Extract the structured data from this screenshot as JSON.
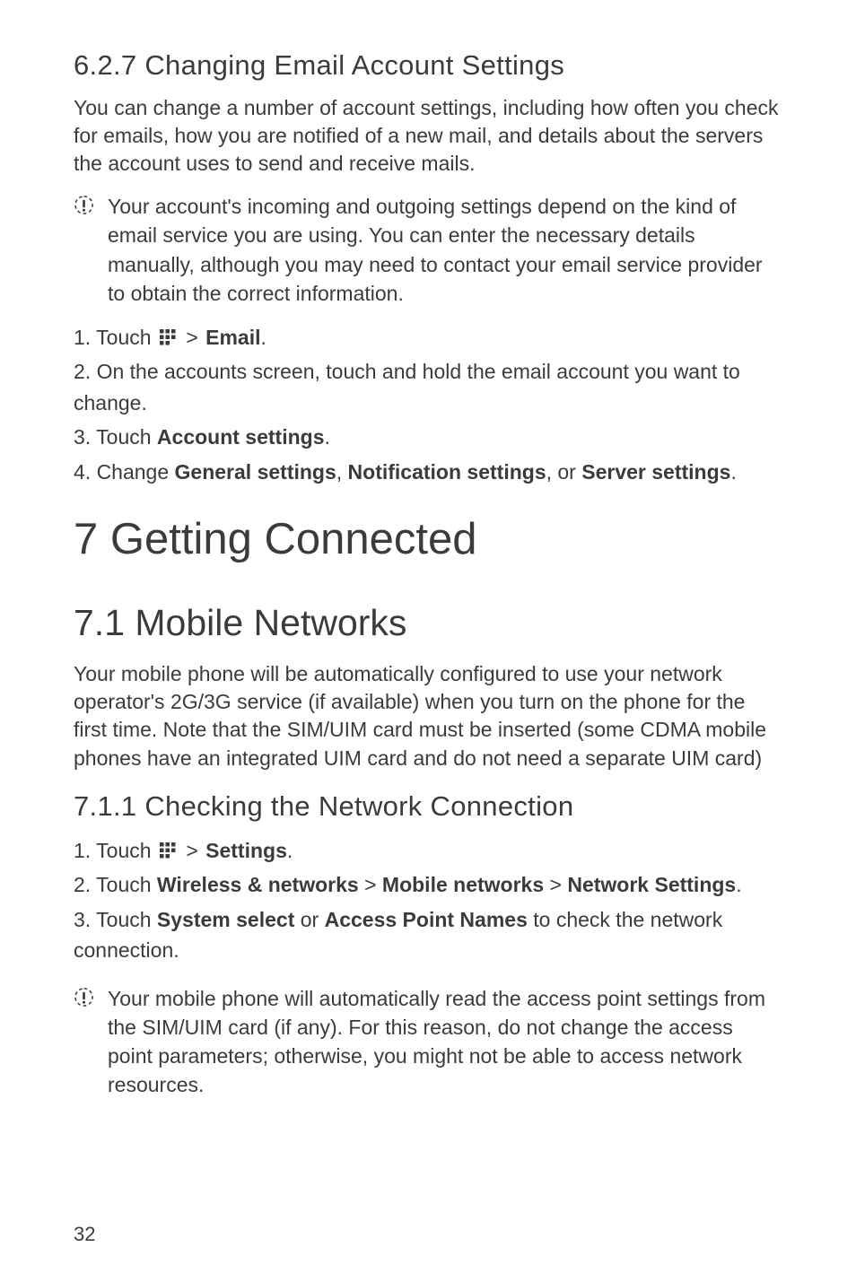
{
  "sec627": {
    "heading": "6.2.7  Changing Email Account Settings",
    "intro": "You can change a number of account settings, including how often you check for emails, how you are notified of a new mail, and details about the servers the account uses to send and receive mails.",
    "note": "Your account's incoming and outgoing settings depend on the kind of email service you are using. You can enter the necessary details manually, although you may need to contact your email service provider to obtain the correct information.",
    "step1_pre": "1. Touch ",
    "step1_post": " > ",
    "step1_bold": "Email",
    "step1_dot": ".",
    "step2": "2. On the accounts screen, touch and hold the email account you want to change.",
    "step3_pre": "3. Touch ",
    "step3_bold": "Account settings",
    "step3_dot": ".",
    "step4_pre": "4. Change ",
    "step4_b1": "General settings",
    "step4_c1": ", ",
    "step4_b2": "Notification settings",
    "step4_c2": ", or ",
    "step4_b3": "Server settings",
    "step4_dot": "."
  },
  "sec7": {
    "heading": "7  Getting Connected"
  },
  "sec71": {
    "heading": "7.1  Mobile Networks",
    "intro": "Your mobile phone will be automatically configured to use your network operator's 2G/3G service (if available) when you turn on the phone for the first time. Note that the SIM/UIM card must be inserted (some CDMA mobile phones have an integrated UIM card and do not need a separate UIM card)"
  },
  "sec711": {
    "heading": "7.1.1  Checking the Network Connection",
    "step1_pre": "1. Touch ",
    "step1_post": " > ",
    "step1_bold": "Settings",
    "step1_dot": ".",
    "step2_pre": "2. Touch ",
    "step2_b1": "Wireless & networks",
    "step2_c1": " > ",
    "step2_b2": "Mobile networks",
    "step2_c2": " > ",
    "step2_b3": "Network Settings",
    "step2_dot": ".",
    "step3_pre": "3. Touch ",
    "step3_b1": "System select",
    "step3_c1": " or ",
    "step3_b2": "Access Point Names",
    "step3_post": " to check the network connection.",
    "note": "Your mobile phone will automatically read the access point settings from the SIM/UIM card (if any). For this reason, do not change the access point parameters; otherwise, you might not be able to access network resources."
  },
  "page_number": "32"
}
